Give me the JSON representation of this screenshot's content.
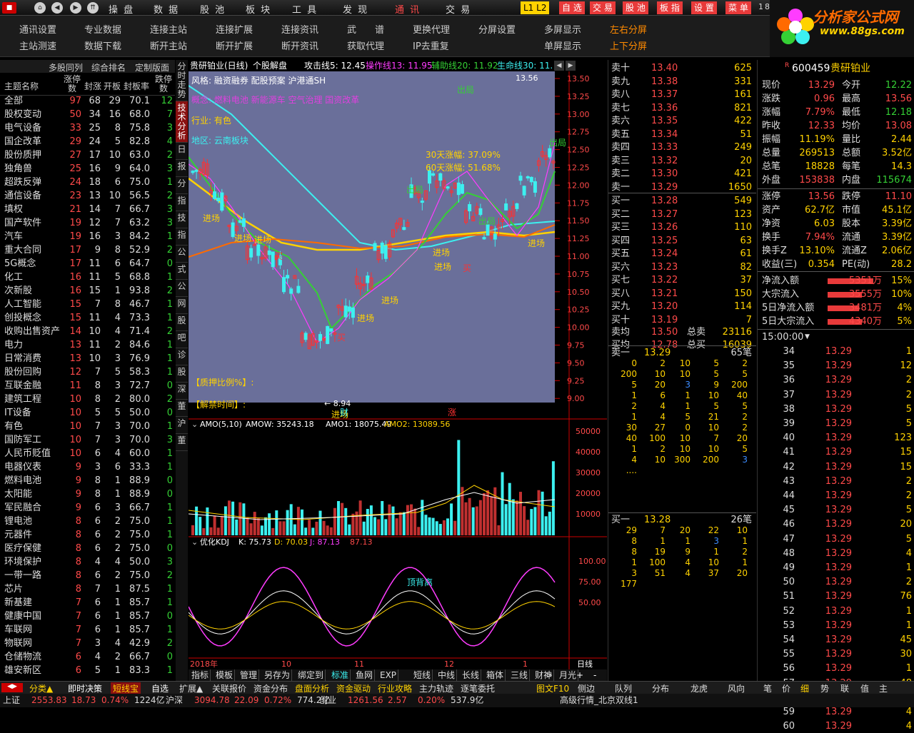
{
  "topbar": {
    "menus": [
      "操 盘",
      "数 据",
      "股 池",
      "板 块",
      "工 具",
      "发 现",
      "通 讯",
      "交 易"
    ],
    "buttons": [
      "L1 L2",
      "自 选",
      "交 易",
      "股 池",
      "板 指",
      "设 置",
      "菜 单"
    ],
    "tail": "18"
  },
  "toolbar": {
    "items": [
      [
        "通讯设置",
        "主站测速"
      ],
      [
        "专业数据",
        "数据下载"
      ],
      [
        "连接主站",
        "断开主站"
      ],
      [
        "连接扩展",
        "断开扩展"
      ],
      [
        "连接资讯",
        "断开资讯"
      ],
      [
        "武　　谱",
        "获取代理"
      ],
      [
        "更换代理",
        "IP去重复"
      ],
      [
        "分屏设置",
        ""
      ],
      [
        "多屏显示",
        "单屏显示"
      ],
      [
        "左右分屏",
        "上下分屏"
      ]
    ]
  },
  "logo": {
    "title": "分析家公式网",
    "url": "www.88gs.com"
  },
  "leftpanel": {
    "tabs": [
      "多股同列",
      "综合排名",
      "定制版面"
    ],
    "headers": [
      "主题名称",
      "涨停数",
      "封涨",
      "开板",
      "封板率",
      "跌停数"
    ],
    "rows": [
      [
        "全部",
        "97",
        "68",
        "29",
        "70.1",
        "12"
      ],
      [
        "股权变动",
        "50",
        "34",
        "16",
        "68.0",
        "7"
      ],
      [
        "电气设备",
        "33",
        "25",
        "8",
        "75.8",
        "3"
      ],
      [
        "国企改革",
        "29",
        "24",
        "5",
        "82.8",
        "4"
      ],
      [
        "股份质押",
        "27",
        "17",
        "10",
        "63.0",
        "2"
      ],
      [
        "独角兽",
        "25",
        "16",
        "9",
        "64.0",
        "3"
      ],
      [
        "超跌反弹",
        "24",
        "18",
        "6",
        "75.0",
        "1"
      ],
      [
        "通信设备",
        "23",
        "13",
        "10",
        "56.5",
        "2"
      ],
      [
        "填权",
        "21",
        "14",
        "7",
        "66.7",
        "3"
      ],
      [
        "国产软件",
        "19",
        "12",
        "7",
        "63.2",
        "3"
      ],
      [
        "汽车",
        "19",
        "16",
        "3",
        "84.2",
        "1"
      ],
      [
        "重大合同",
        "17",
        "9",
        "8",
        "52.9",
        "2"
      ],
      [
        "5G概念",
        "17",
        "11",
        "6",
        "64.7",
        "0"
      ],
      [
        "化工",
        "16",
        "11",
        "5",
        "68.8",
        "1"
      ],
      [
        "次新股",
        "16",
        "15",
        "1",
        "93.8",
        "2"
      ],
      [
        "人工智能",
        "15",
        "7",
        "8",
        "46.7",
        "1"
      ],
      [
        "创投概念",
        "15",
        "11",
        "4",
        "73.3",
        "1"
      ],
      [
        "收购出售资产",
        "14",
        "10",
        "4",
        "71.4",
        "2"
      ],
      [
        "电力",
        "13",
        "11",
        "2",
        "84.6",
        "1"
      ],
      [
        "日常消费",
        "13",
        "10",
        "3",
        "76.9",
        "1"
      ],
      [
        "股份回购",
        "12",
        "7",
        "5",
        "58.3",
        "1"
      ],
      [
        "互联金融",
        "11",
        "8",
        "3",
        "72.7",
        "0"
      ],
      [
        "建筑工程",
        "10",
        "8",
        "2",
        "80.0",
        "2"
      ],
      [
        "IT设备",
        "10",
        "5",
        "5",
        "50.0",
        "0"
      ],
      [
        "有色",
        "10",
        "7",
        "3",
        "70.0",
        "1"
      ],
      [
        "国防军工",
        "10",
        "7",
        "3",
        "70.0",
        "3"
      ],
      [
        "人民币贬值",
        "10",
        "6",
        "4",
        "60.0",
        "1"
      ],
      [
        "电器仪表",
        "9",
        "3",
        "6",
        "33.3",
        "1"
      ],
      [
        "燃料电池",
        "9",
        "8",
        "1",
        "88.9",
        "0"
      ],
      [
        "太阳能",
        "9",
        "8",
        "1",
        "88.9",
        "0"
      ],
      [
        "军民融合",
        "9",
        "6",
        "3",
        "66.7",
        "1"
      ],
      [
        "锂电池",
        "8",
        "6",
        "2",
        "75.0",
        "1"
      ],
      [
        "元器件",
        "8",
        "6",
        "2",
        "75.0",
        "1"
      ],
      [
        "医疗保健",
        "8",
        "6",
        "2",
        "75.0",
        "0"
      ],
      [
        "环境保护",
        "8",
        "4",
        "4",
        "50.0",
        "3"
      ],
      [
        "一带一路",
        "8",
        "6",
        "2",
        "75.0",
        "2"
      ],
      [
        "芯片",
        "8",
        "7",
        "1",
        "87.5",
        "1"
      ],
      [
        "新基建",
        "7",
        "6",
        "1",
        "85.7",
        "1"
      ],
      [
        "健康中国",
        "7",
        "6",
        "1",
        "85.7",
        "0"
      ],
      [
        "车联网",
        "7",
        "6",
        "1",
        "85.7",
        "1"
      ],
      [
        "物联网",
        "7",
        "3",
        "4",
        "42.9",
        "2"
      ],
      [
        "仓储物流",
        "6",
        "4",
        "2",
        "66.7",
        "0"
      ],
      [
        "雄安新区",
        "6",
        "5",
        "1",
        "83.3",
        "1"
      ]
    ]
  },
  "vtabs": [
    "分时走势",
    "技术分析",
    "日",
    "报",
    "分",
    "指",
    "技",
    "指",
    "公",
    "式",
    "公",
    "网",
    "股",
    "吧",
    "诊",
    "股",
    "深",
    "董",
    "沪",
    "董"
  ],
  "chart": {
    "title": "贵研铂业(日线)",
    "mode": "个股解盘",
    "lines": [
      {
        "label": "攻击线5: 12.45",
        "color": "#ffffff"
      },
      {
        "label": "操作线13: 11.95",
        "color": "#ff3cff"
      },
      {
        "label": "辅助线20: 11.92",
        "color": "#35d035"
      },
      {
        "label": "生命线30: 11.",
        "color": "#3cf0f0"
      }
    ],
    "info": {
      "style": "风格: 融资融券 配股预案 沪港通SH",
      "concept": "概念: 燃料电池 新能源车 空气治理 国资改革",
      "industry": "行业: 有色",
      "region": "地区: 云南板块",
      "pledge": "【质押比例%】:",
      "ban": "【解禁时间】:",
      "zh30": "30天涨幅: 37.09%",
      "zh60": "60天涨幅: 51.68%",
      "low": "8.94",
      "high": "13.56"
    },
    "yaxis": [
      "13.50",
      "13.25",
      "13.00",
      "12.75",
      "12.50",
      "12.25",
      "12.00",
      "11.75",
      "11.50",
      "11.25",
      "11.00",
      "10.75",
      "10.50",
      "10.25",
      "10.00",
      "9.75",
      "9.50",
      "9.25",
      "9.00"
    ],
    "signals": [
      "进场",
      "进场",
      "进场",
      "进场",
      "进场",
      "进场",
      "进场",
      "进场",
      "进场",
      "出局",
      "出局",
      "出局",
      "出局",
      "买",
      "买",
      "买",
      "财",
      "涨"
    ],
    "amo": {
      "label": "AMO(5,10)",
      "amow": "AMOW: 35243.18",
      "amo1": "AMO1: 18075.49",
      "amo2": "AMO2: 13089.56",
      "yaxis": [
        "50000",
        "40000",
        "30000",
        "20000",
        "10000"
      ]
    },
    "kdj": {
      "label": "优化KDJ",
      "k": "K: 75.73",
      "d": "D: 70.03",
      "j": "J: 87.13",
      "j2": "87.13",
      "note": "顶背离",
      "yaxis": [
        "100.00",
        "75.00",
        "50.00"
      ]
    },
    "xaxis": [
      "2018年",
      "10",
      "11",
      "12",
      "1",
      "日线"
    ],
    "toolbar": [
      "指标",
      "模板",
      "管理",
      "另存为",
      "绑定到",
      "标准",
      "鱼网",
      "EXP",
      "短线",
      "中线",
      "长线",
      "箱体",
      "三线",
      "财神",
      "月光"
    ]
  },
  "book": {
    "sells": [
      [
        "卖十",
        "13.40",
        "625"
      ],
      [
        "卖九",
        "13.38",
        "331"
      ],
      [
        "卖八",
        "13.37",
        "161"
      ],
      [
        "卖七",
        "13.36",
        "821"
      ],
      [
        "卖六",
        "13.35",
        "422"
      ],
      [
        "卖五",
        "13.34",
        "51"
      ],
      [
        "卖四",
        "13.33",
        "249"
      ],
      [
        "卖三",
        "13.32",
        "20"
      ],
      [
        "卖二",
        "13.30",
        "421"
      ],
      [
        "卖一",
        "13.29",
        "1650"
      ]
    ],
    "buys": [
      [
        "买一",
        "13.28",
        "549"
      ],
      [
        "买二",
        "13.27",
        "123"
      ],
      [
        "买三",
        "13.26",
        "110"
      ],
      [
        "买四",
        "13.25",
        "63"
      ],
      [
        "买五",
        "13.24",
        "61"
      ],
      [
        "买六",
        "13.23",
        "82"
      ],
      [
        "买七",
        "13.22",
        "37"
      ],
      [
        "买八",
        "13.21",
        "150"
      ],
      [
        "买九",
        "13.20",
        "114"
      ],
      [
        "买十",
        "13.19",
        "7"
      ]
    ],
    "avg": [
      [
        "卖均",
        "13.50",
        "总卖",
        "23116"
      ],
      [
        "买均",
        "12.78",
        "总买",
        "16039"
      ]
    ],
    "sell1": {
      "label": "卖一",
      "price": "13.29",
      "count": "65笔"
    },
    "sellq": [
      [
        "0",
        "2",
        "10",
        "5",
        "2"
      ],
      [
        "200",
        "10",
        "10",
        "5",
        "5"
      ],
      [
        "5",
        "20",
        "3",
        "9",
        "200"
      ],
      [
        "1",
        "6",
        "1",
        "10",
        "40"
      ],
      [
        "2",
        "4",
        "1",
        "5",
        "5"
      ],
      [
        "1",
        "4",
        "5",
        "21",
        "2"
      ],
      [
        "30",
        "27",
        "0",
        "10",
        "2"
      ],
      [
        "40",
        "100",
        "10",
        "7",
        "20"
      ],
      [
        "1",
        "2",
        "10",
        "10",
        "5"
      ],
      [
        "4",
        "10",
        "300",
        "200",
        "3"
      ],
      [
        "....",
        "",
        "",
        "",
        ""
      ]
    ],
    "buy1": {
      "label": "买一",
      "price": "13.28",
      "count": "26笔"
    },
    "buyq": [
      [
        "29",
        "7",
        "20",
        "22",
        "10"
      ],
      [
        "8",
        "1",
        "1",
        "3",
        "1"
      ],
      [
        "8",
        "19",
        "9",
        "1",
        "2"
      ],
      [
        "1",
        "100",
        "4",
        "10",
        "1"
      ],
      [
        "3",
        "51",
        "4",
        "37",
        "20"
      ],
      [
        "177",
        "",
        "",
        "",
        ""
      ]
    ]
  },
  "info": {
    "code": "600459",
    "name": "贵研铂业",
    "rows": [
      [
        "现价",
        "13.29",
        "今开",
        "12.22"
      ],
      [
        "涨跌",
        "0.96",
        "最高",
        "13.56"
      ],
      [
        "涨幅",
        "7.79%",
        "最低",
        "12.18"
      ],
      [
        "昨收",
        "12.33",
        "均价",
        "13.08"
      ],
      [
        "振幅",
        "11.19%",
        "量比",
        "2.44"
      ],
      [
        "总量",
        "269513",
        "总额",
        "3.52亿"
      ],
      [
        "总笔",
        "18828",
        "每笔",
        "14.3"
      ],
      [
        "外盘",
        "153838",
        "内盘",
        "115674"
      ],
      [
        "涨停",
        "13.56",
        "跌停",
        "11.10"
      ],
      [
        "资产",
        "62.7亿",
        "市值",
        "45.1亿"
      ],
      [
        "净资",
        "6.03",
        "股本",
        "3.39亿"
      ],
      [
        "换手",
        "7.94%",
        "流通",
        "3.39亿"
      ],
      [
        "换手Z",
        "13.10%",
        "流通Z",
        "2.06亿"
      ],
      [
        "收益(三)",
        "0.354",
        "PE(动)",
        "28.2"
      ]
    ],
    "flows": [
      [
        "净流入额",
        "5351万",
        "15%"
      ],
      [
        "大宗流入",
        "3555万",
        "10%"
      ],
      [
        "5日净流入额",
        "3481万",
        "4%"
      ],
      [
        "5日大宗流入",
        "4340万",
        "5%"
      ]
    ],
    "tick_time": "15:00:00",
    "ticks": [
      [
        "34",
        "13.29",
        "1"
      ],
      [
        "35",
        "13.29",
        "12"
      ],
      [
        "36",
        "13.29",
        "2"
      ],
      [
        "37",
        "13.29",
        "2"
      ],
      [
        "38",
        "13.29",
        "5"
      ],
      [
        "39",
        "13.29",
        "5"
      ],
      [
        "40",
        "13.29",
        "123"
      ],
      [
        "41",
        "13.29",
        "15"
      ],
      [
        "42",
        "13.29",
        "15"
      ],
      [
        "43",
        "13.29",
        "2"
      ],
      [
        "44",
        "13.29",
        "2"
      ],
      [
        "45",
        "13.29",
        "5"
      ],
      [
        "46",
        "13.29",
        "20"
      ],
      [
        "47",
        "13.29",
        "5"
      ],
      [
        "48",
        "13.29",
        "4"
      ],
      [
        "49",
        "13.29",
        "1"
      ],
      [
        "50",
        "13.29",
        "2"
      ],
      [
        "51",
        "13.29",
        "76"
      ],
      [
        "52",
        "13.29",
        "1"
      ],
      [
        "53",
        "13.29",
        "1"
      ],
      [
        "54",
        "13.29",
        "45"
      ],
      [
        "55",
        "13.29",
        "30"
      ],
      [
        "56",
        "13.29",
        "1"
      ],
      [
        "57",
        "13.29",
        "48"
      ],
      [
        "58",
        "13.29",
        "25"
      ],
      [
        "59",
        "13.29",
        "4"
      ],
      [
        "60",
        "13.29",
        "4"
      ]
    ]
  },
  "bottom": {
    "tabs_left": [
      "分类▲",
      "即时决策",
      "短线宝",
      "自选"
    ],
    "tabs_mid": [
      "扩展▲",
      "关联报价",
      "资金分布",
      "盘面分析",
      "资金驱动",
      "行业攻略",
      "主力轨迹",
      "逐笔委托"
    ],
    "tabs_right": [
      "图文F10",
      "侧边",
      "队列",
      "分布",
      "龙虎",
      "风向",
      "笔",
      "价",
      "细",
      "势",
      "联",
      "值",
      "主"
    ],
    "status": [
      {
        "label": "上证",
        "value": "2553.83",
        "chg": "18.73",
        "pct": "0.74%",
        "amt": "1224亿"
      },
      {
        "label": "沪深",
        "value": "3094.78",
        "chg": "22.09",
        "pct": "0.72%",
        "amt": "774.2亿"
      },
      {
        "label": "创业",
        "value": "1261.56",
        "chg": "2.57",
        "pct": "0.20%",
        "amt": "537.9亿"
      }
    ],
    "note": "高级行情_北京双线1"
  }
}
